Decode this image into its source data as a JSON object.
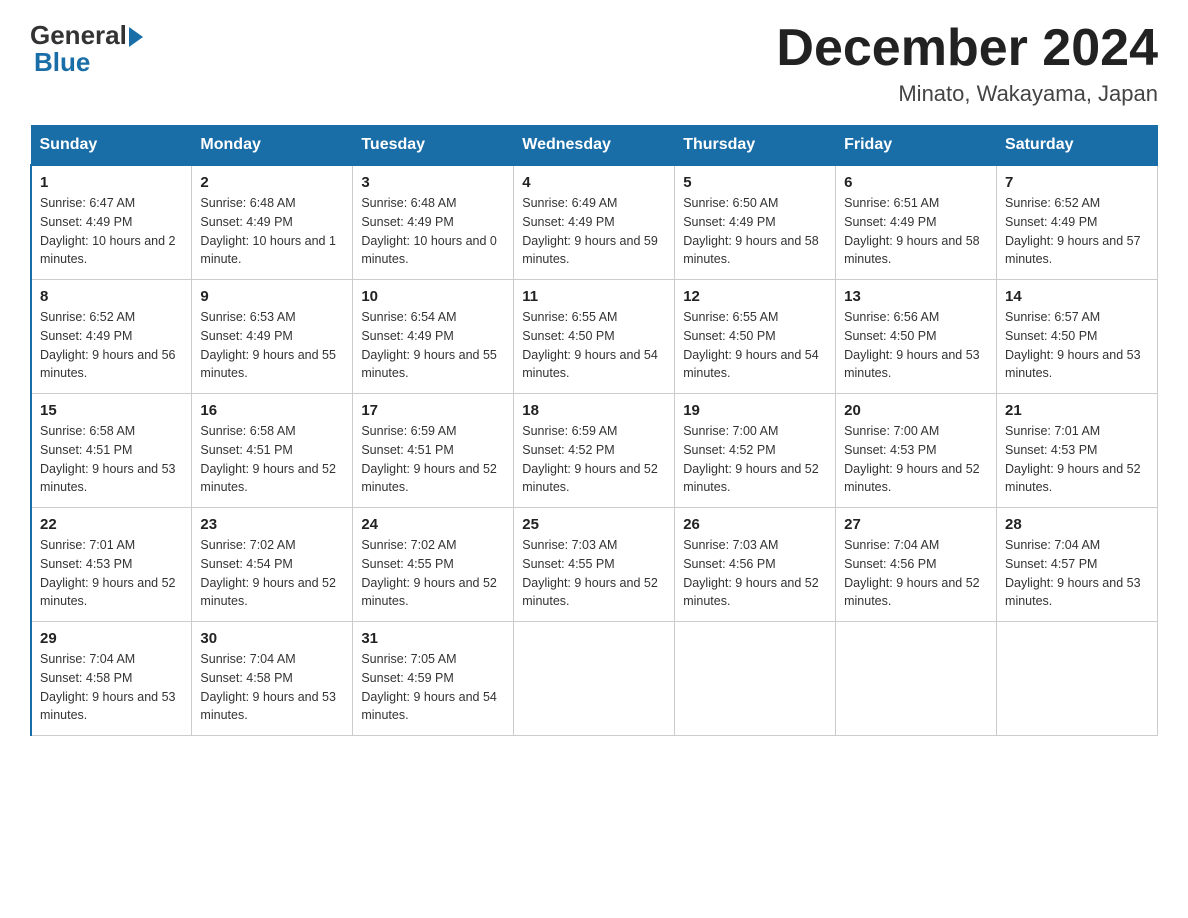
{
  "logo": {
    "general": "General",
    "blue": "Blue",
    "subtitle": "Blue"
  },
  "header": {
    "month": "December 2024",
    "location": "Minato, Wakayama, Japan"
  },
  "days_of_week": [
    "Sunday",
    "Monday",
    "Tuesday",
    "Wednesday",
    "Thursday",
    "Friday",
    "Saturday"
  ],
  "weeks": [
    [
      {
        "day": "1",
        "sunrise": "6:47 AM",
        "sunset": "4:49 PM",
        "daylight": "10 hours and 2 minutes."
      },
      {
        "day": "2",
        "sunrise": "6:48 AM",
        "sunset": "4:49 PM",
        "daylight": "10 hours and 1 minute."
      },
      {
        "day": "3",
        "sunrise": "6:48 AM",
        "sunset": "4:49 PM",
        "daylight": "10 hours and 0 minutes."
      },
      {
        "day": "4",
        "sunrise": "6:49 AM",
        "sunset": "4:49 PM",
        "daylight": "9 hours and 59 minutes."
      },
      {
        "day": "5",
        "sunrise": "6:50 AM",
        "sunset": "4:49 PM",
        "daylight": "9 hours and 58 minutes."
      },
      {
        "day": "6",
        "sunrise": "6:51 AM",
        "sunset": "4:49 PM",
        "daylight": "9 hours and 58 minutes."
      },
      {
        "day": "7",
        "sunrise": "6:52 AM",
        "sunset": "4:49 PM",
        "daylight": "9 hours and 57 minutes."
      }
    ],
    [
      {
        "day": "8",
        "sunrise": "6:52 AM",
        "sunset": "4:49 PM",
        "daylight": "9 hours and 56 minutes."
      },
      {
        "day": "9",
        "sunrise": "6:53 AM",
        "sunset": "4:49 PM",
        "daylight": "9 hours and 55 minutes."
      },
      {
        "day": "10",
        "sunrise": "6:54 AM",
        "sunset": "4:49 PM",
        "daylight": "9 hours and 55 minutes."
      },
      {
        "day": "11",
        "sunrise": "6:55 AM",
        "sunset": "4:50 PM",
        "daylight": "9 hours and 54 minutes."
      },
      {
        "day": "12",
        "sunrise": "6:55 AM",
        "sunset": "4:50 PM",
        "daylight": "9 hours and 54 minutes."
      },
      {
        "day": "13",
        "sunrise": "6:56 AM",
        "sunset": "4:50 PM",
        "daylight": "9 hours and 53 minutes."
      },
      {
        "day": "14",
        "sunrise": "6:57 AM",
        "sunset": "4:50 PM",
        "daylight": "9 hours and 53 minutes."
      }
    ],
    [
      {
        "day": "15",
        "sunrise": "6:58 AM",
        "sunset": "4:51 PM",
        "daylight": "9 hours and 53 minutes."
      },
      {
        "day": "16",
        "sunrise": "6:58 AM",
        "sunset": "4:51 PM",
        "daylight": "9 hours and 52 minutes."
      },
      {
        "day": "17",
        "sunrise": "6:59 AM",
        "sunset": "4:51 PM",
        "daylight": "9 hours and 52 minutes."
      },
      {
        "day": "18",
        "sunrise": "6:59 AM",
        "sunset": "4:52 PM",
        "daylight": "9 hours and 52 minutes."
      },
      {
        "day": "19",
        "sunrise": "7:00 AM",
        "sunset": "4:52 PM",
        "daylight": "9 hours and 52 minutes."
      },
      {
        "day": "20",
        "sunrise": "7:00 AM",
        "sunset": "4:53 PM",
        "daylight": "9 hours and 52 minutes."
      },
      {
        "day": "21",
        "sunrise": "7:01 AM",
        "sunset": "4:53 PM",
        "daylight": "9 hours and 52 minutes."
      }
    ],
    [
      {
        "day": "22",
        "sunrise": "7:01 AM",
        "sunset": "4:53 PM",
        "daylight": "9 hours and 52 minutes."
      },
      {
        "day": "23",
        "sunrise": "7:02 AM",
        "sunset": "4:54 PM",
        "daylight": "9 hours and 52 minutes."
      },
      {
        "day": "24",
        "sunrise": "7:02 AM",
        "sunset": "4:55 PM",
        "daylight": "9 hours and 52 minutes."
      },
      {
        "day": "25",
        "sunrise": "7:03 AM",
        "sunset": "4:55 PM",
        "daylight": "9 hours and 52 minutes."
      },
      {
        "day": "26",
        "sunrise": "7:03 AM",
        "sunset": "4:56 PM",
        "daylight": "9 hours and 52 minutes."
      },
      {
        "day": "27",
        "sunrise": "7:04 AM",
        "sunset": "4:56 PM",
        "daylight": "9 hours and 52 minutes."
      },
      {
        "day": "28",
        "sunrise": "7:04 AM",
        "sunset": "4:57 PM",
        "daylight": "9 hours and 53 minutes."
      }
    ],
    [
      {
        "day": "29",
        "sunrise": "7:04 AM",
        "sunset": "4:58 PM",
        "daylight": "9 hours and 53 minutes."
      },
      {
        "day": "30",
        "sunrise": "7:04 AM",
        "sunset": "4:58 PM",
        "daylight": "9 hours and 53 minutes."
      },
      {
        "day": "31",
        "sunrise": "7:05 AM",
        "sunset": "4:59 PM",
        "daylight": "9 hours and 54 minutes."
      },
      null,
      null,
      null,
      null
    ]
  ]
}
